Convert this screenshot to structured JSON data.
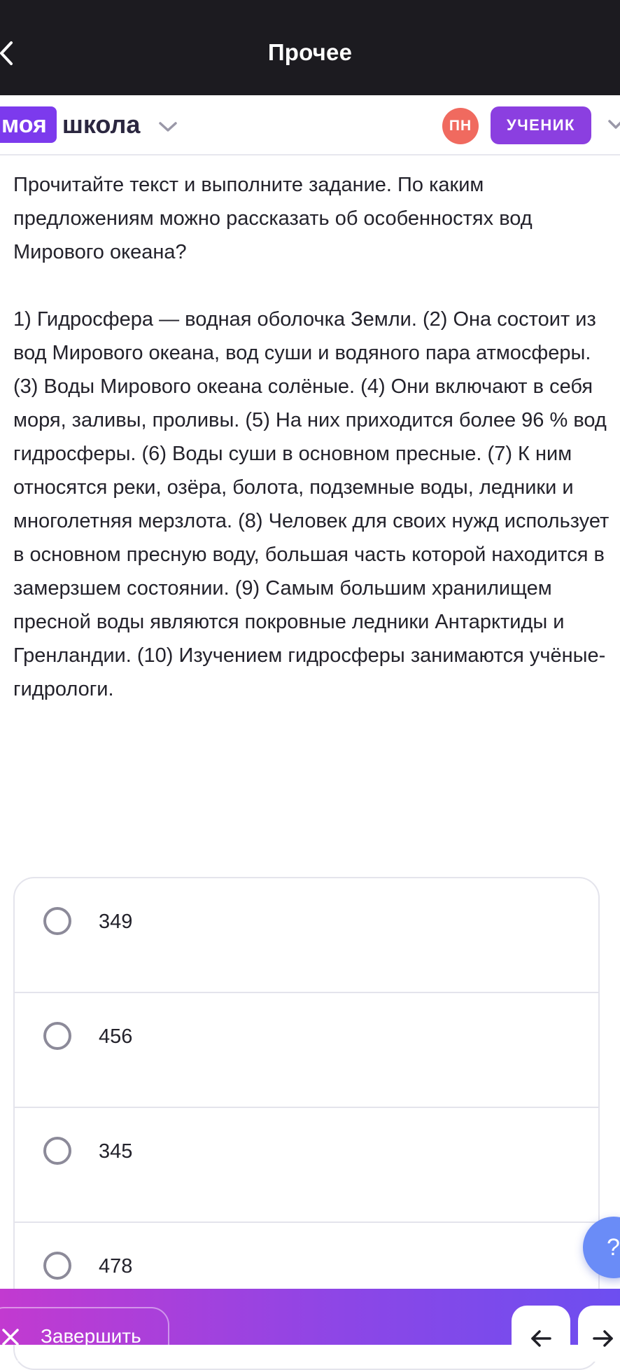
{
  "header": {
    "title": "Прочее"
  },
  "school_bar": {
    "logo_part1": "моя",
    "logo_part2": "школа",
    "avatar_initials": "ПН",
    "role_label": "УЧЕНИК"
  },
  "question": {
    "prompt": "Прочитайте текст и выполните задание. По каким предложениям можно рассказать об особенностях вод Мирового океана?",
    "text": "1) Гидросфера — водная оболочка Земли. (2) Она состоит из вод Мирового океана, вод суши и водяного пара атмосферы. (3) Воды Мирового океана солёные. (4) Они включают в себя моря, заливы, проливы. (5) На них приходится более 96 % вод гидросферы. (6) Воды суши в основном пресные. (7) К ним относятся реки, озёра, болота, подземные воды, ледники и многолетняя мерзлота. (8) Человек для своих нужд использует в основном пресную воду, большая часть которой находится в замерзшем состоянии. (9) Самым большим хранилищем пресной воды являются покровные ледники Антарктиды и Гренландии. (10) Изучением гидросферы занимаются учёные-гидрологи."
  },
  "options": [
    {
      "label": "349"
    },
    {
      "label": "456"
    },
    {
      "label": "345"
    },
    {
      "label": "478"
    }
  ],
  "help": {
    "label": "?"
  },
  "footer": {
    "finish_label": "Завершить"
  },
  "colors": {
    "header_bg": "#1c1b20",
    "brand_purple": "#7c3aed",
    "role_badge": "#8b3fe0",
    "avatar": "#f06a5f",
    "help_button": "#6a8cf7",
    "footer_gradient_start": "#c23ad0",
    "footer_gradient_end": "#6d4ef0"
  },
  "icons": {
    "back": "chevron-left-icon",
    "school_dropdown": "chevron-down-icon",
    "role_dropdown": "chevron-down-icon",
    "finish": "close-icon",
    "prev": "arrow-left-icon",
    "next": "arrow-right-icon"
  }
}
